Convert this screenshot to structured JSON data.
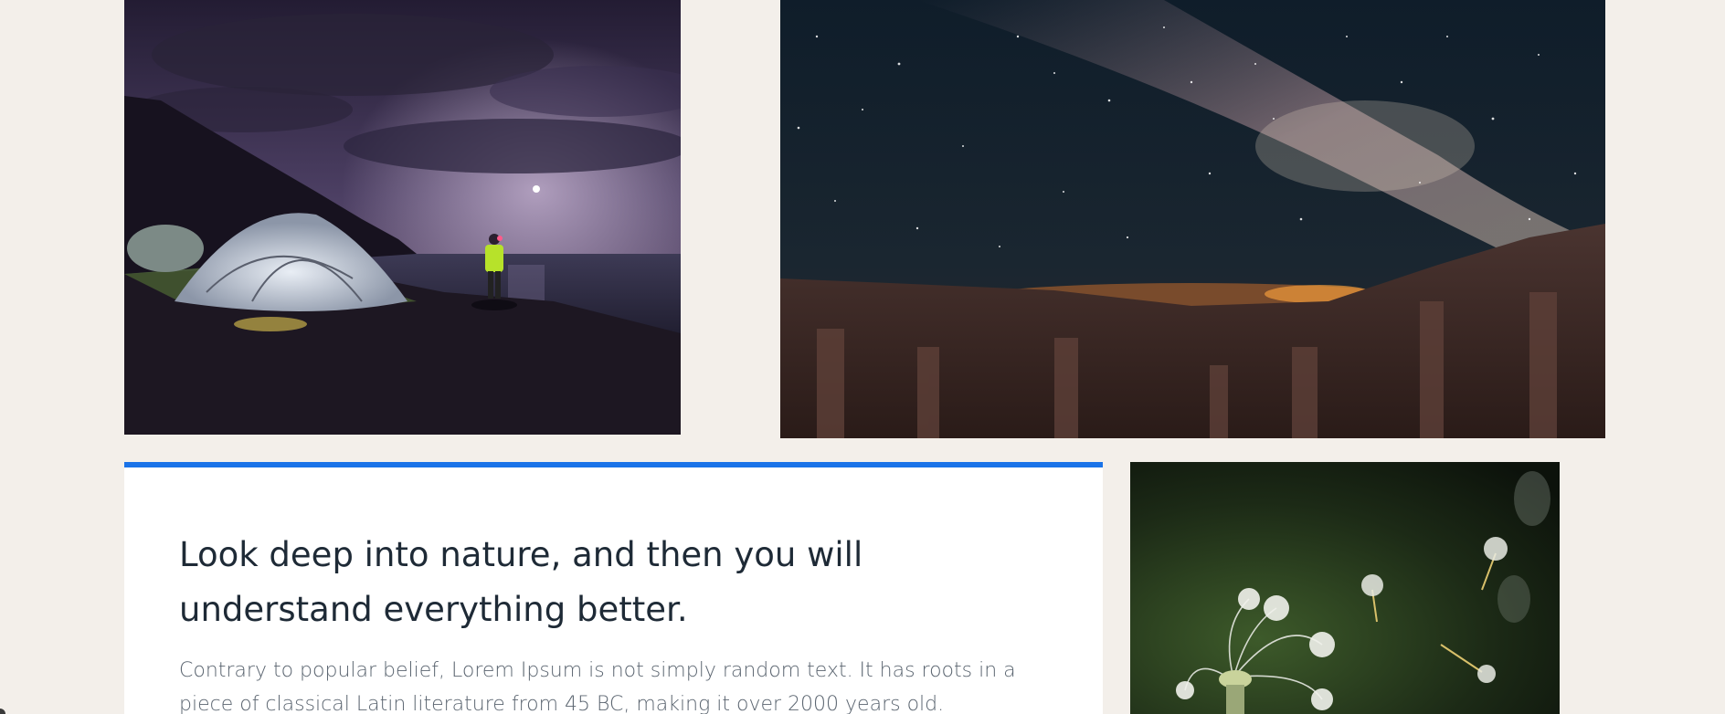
{
  "gallery": {
    "images": [
      {
        "alt": "night-camping-photo"
      },
      {
        "alt": "milky-way-canyon-photo"
      },
      {
        "alt": "dandelion-seeds-photo"
      }
    ]
  },
  "quote": {
    "heading": "Look deep into nature, and then you will understand everything better.",
    "body": "Contrary to popular belief, Lorem Ipsum is not simply random text. It has roots in a piece of classical Latin literature from 45 BC, making it over 2000 years old."
  },
  "colors": {
    "page_background": "#f3efea",
    "accent_border": "#1a73e8",
    "heading_text": "#1e2a36",
    "body_text": "#5b6570"
  }
}
